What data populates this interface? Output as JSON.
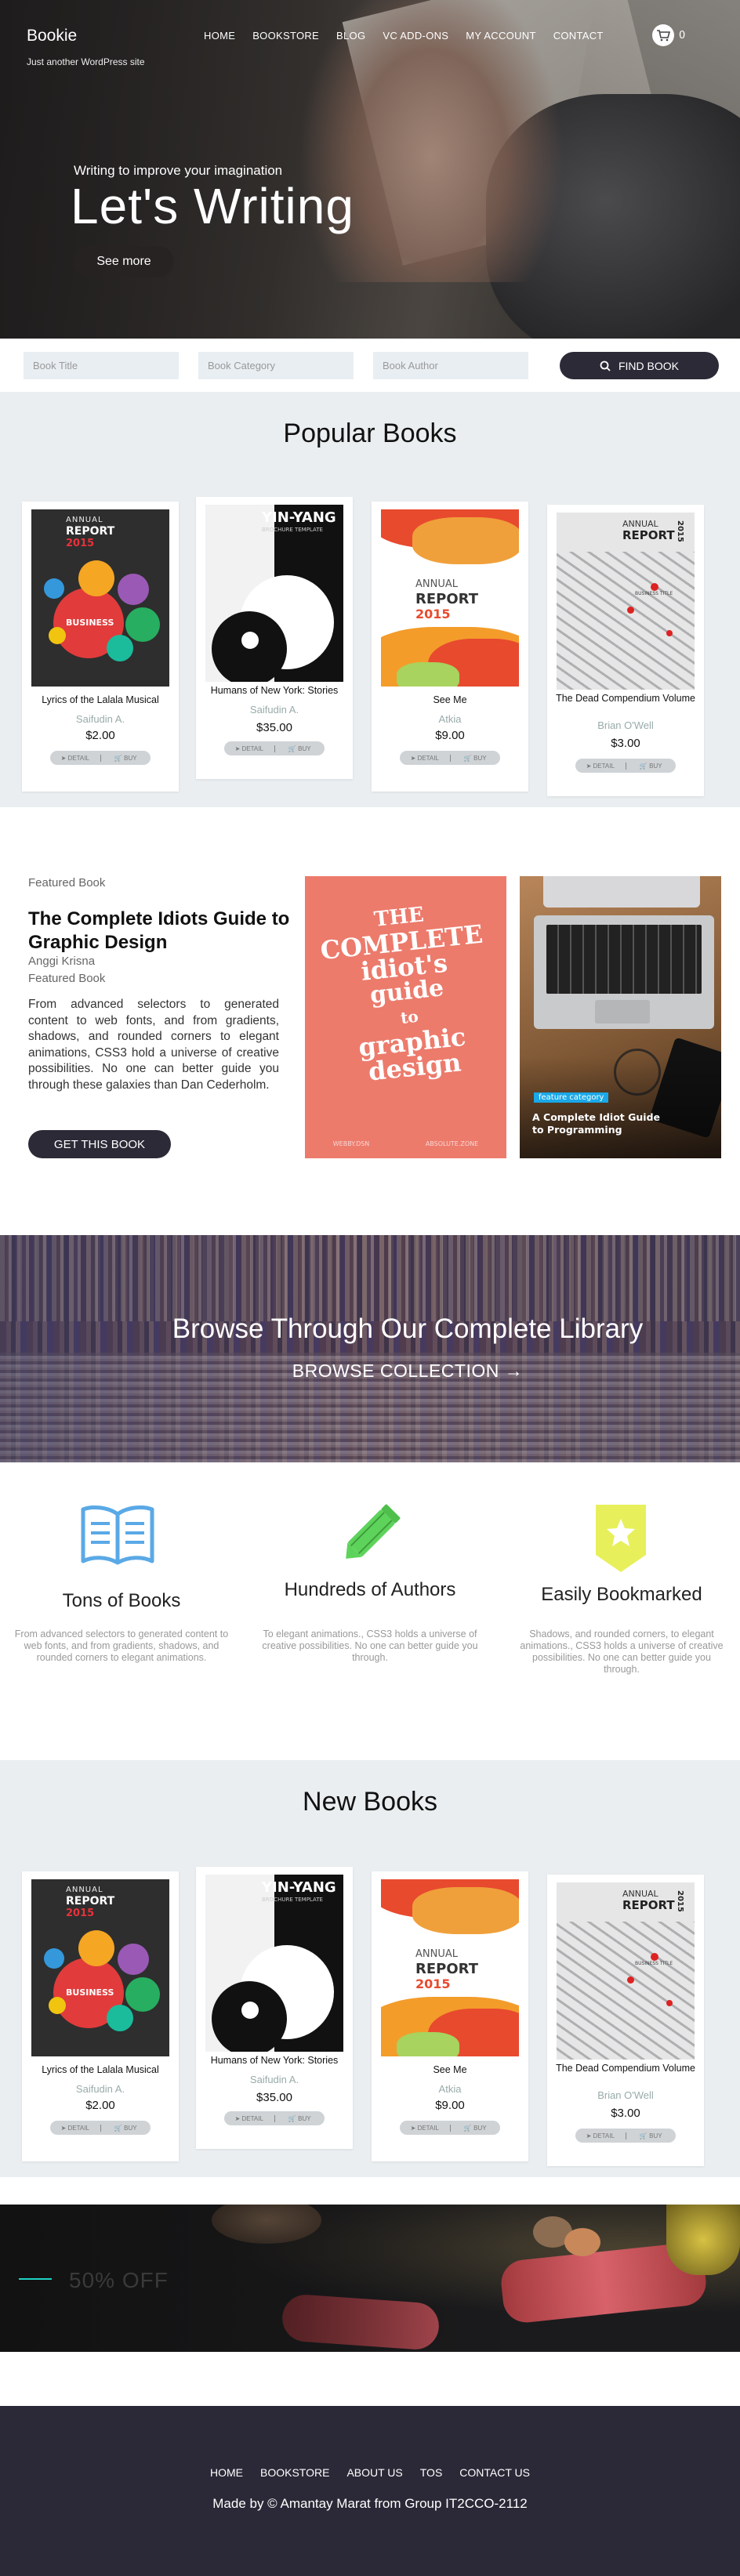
{
  "site": {
    "name": "Bookie",
    "tagline": "Just another WordPress site"
  },
  "nav": {
    "items": [
      "HOME",
      "BOOKSTORE",
      "BLOG",
      "VC ADD-ONS",
      "MY ACCOUNT",
      "CONTACT"
    ],
    "cart_count": "0"
  },
  "hero": {
    "subtitle": "Writing to improve your imagination",
    "title": "Let's Writing",
    "button": "See more"
  },
  "search": {
    "title_placeholder": "Book Title",
    "category_placeholder": "Book Category",
    "author_placeholder": "Book Author",
    "button": "FIND BOOK"
  },
  "popular": {
    "title": "Popular Books",
    "books": [
      {
        "title": "Lyrics of the Lalala Musical",
        "author": "Saifudin A.",
        "price": "$2.00",
        "detail": "DETAIL",
        "buy": "BUY"
      },
      {
        "title": "Humans of New York: Stories",
        "author": "Saifudin A.",
        "price": "$35.00",
        "detail": "DETAIL",
        "buy": "BUY"
      },
      {
        "title": "See Me",
        "author": "Atkia",
        "price": "$9.00",
        "detail": "DETAIL",
        "buy": "BUY"
      },
      {
        "title": "The Dead Compendium Volume",
        "author": "Brian O'Well",
        "price": "$3.00",
        "detail": "DETAIL",
        "buy": "BUY"
      }
    ]
  },
  "covers": {
    "annual": {
      "top": "ANNUAL",
      "report": "REPORT",
      "year": "2015",
      "business": "BUSINESS"
    },
    "yinyang": {
      "title": "YIN-YANG",
      "sub": "BROCHURE TEMPLATE"
    },
    "seeme": {
      "top": "ANNUAL",
      "report": "REPORT",
      "year": "2015"
    },
    "dead": {
      "top": "ANNUAL",
      "report": "REPORT",
      "year": "2015",
      "label": "BUSINESS TITLE"
    }
  },
  "featured": {
    "label": "Featured Book",
    "title": "The Complete Idiots Guide to Graphic Design",
    "author": "Anggi Krisna",
    "category_label": "Featured Book",
    "description": "From advanced selectors to generated content to web fonts, and from gradients, shadows, and rounded corners to elegant animations, CSS3 hold a universe of creative possibilities. No one can better guide you through these galaxies than Dan Cederholm.",
    "button": "GET THIS BOOK",
    "cover_text": [
      "THE",
      "COMPLETE",
      "idiot's",
      "guide",
      "to",
      "graphic",
      "design"
    ],
    "cover_footer": [
      "WEBBY.DSN",
      "ABSOLUTE.ZONE"
    ],
    "side_tag": "feature category",
    "side_title": "A Complete Idiot Guide to Programming"
  },
  "library": {
    "title": "Browse Through Our Complete Library",
    "link": "BROWSE COLLECTION →"
  },
  "features": [
    {
      "icon": "book-icon",
      "title": "Tons of Books",
      "text": "From advanced selectors to generated content to web fonts, and from gradients, shadows, and rounded corners to elegant animations."
    },
    {
      "icon": "pencil-icon",
      "title": "Hundreds of Authors",
      "text": "To elegant animations., CSS3 holds a universe of creative possibilities. No one can better guide you through."
    },
    {
      "icon": "bookmark-icon",
      "title": "Easily Bookmarked",
      "text": "Shadows, and rounded corners, to elegant animations., CSS3 holds a universe of creative possibilities. No one can better guide you through."
    }
  ],
  "newbooks": {
    "title": "New Books",
    "books": [
      {
        "title": "Lyrics of the Lalala Musical",
        "author": "Saifudin A.",
        "price": "$2.00",
        "detail": "DETAIL",
        "buy": "BUY"
      },
      {
        "title": "Humans of New York: Stories",
        "author": "Saifudin A.",
        "price": "$35.00",
        "detail": "DETAIL",
        "buy": "BUY"
      },
      {
        "title": "See Me",
        "author": "Atkia",
        "price": "$9.00",
        "detail": "DETAIL",
        "buy": "BUY"
      },
      {
        "title": "The Dead Compendium Volume",
        "author": "Brian O'Well",
        "price": "$3.00",
        "detail": "DETAIL",
        "buy": "BUY"
      }
    ]
  },
  "promo": {
    "text": "50% OFF"
  },
  "footer": {
    "links": [
      "HOME",
      "BOOKSTORE",
      "ABOUT US",
      "TOS",
      "CONTACT US"
    ],
    "copyright": "Made by © Amantay Marat from Group IT2CCO-2112"
  },
  "colors": {
    "dark": "#2c2a37",
    "gray_bg": "#eaeef0",
    "blue_icon": "#5aa9e6",
    "green_icon": "#5ed35b",
    "yellow_icon": "#e7f05a",
    "annual_red": "#d9262e"
  }
}
